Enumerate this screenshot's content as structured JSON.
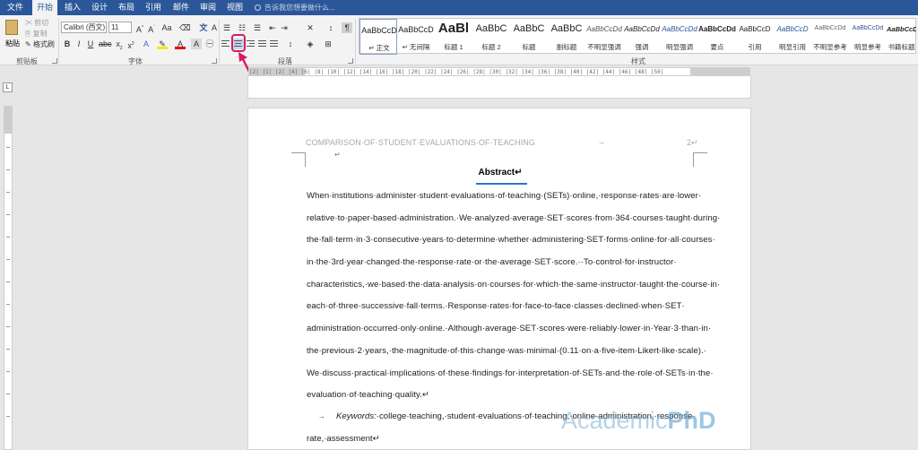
{
  "tabs": [
    "文件",
    "开始",
    "插入",
    "设计",
    "布局",
    "引用",
    "邮件",
    "审阅",
    "视图"
  ],
  "tell_me": "告诉我您想要做什么...",
  "clipboard": {
    "paste": "粘贴",
    "cut": "剪切",
    "copy": "复制",
    "format_painter": "格式刷",
    "group_label": "剪贴板"
  },
  "font": {
    "name": "Calibri (西文)",
    "size": "11",
    "group_label": "字体"
  },
  "paragraph": {
    "group_label": "段落"
  },
  "styles": {
    "group_label": "样式",
    "items": [
      {
        "sample": "AaBbCcD",
        "name": "↵ 正文"
      },
      {
        "sample": "AaBbCcD",
        "name": "↵ 无间隔"
      },
      {
        "sample": "AaBl",
        "name": "标题 1"
      },
      {
        "sample": "AaBbC",
        "name": "标题 2"
      },
      {
        "sample": "AaBbC",
        "name": "标题"
      },
      {
        "sample": "AaBbC",
        "name": "副标题"
      },
      {
        "sample": "AaBbCcDd",
        "name": "不明显强调"
      },
      {
        "sample": "AaBbCcDd",
        "name": "强调"
      },
      {
        "sample": "AaBbCcDd",
        "name": "明显强调"
      },
      {
        "sample": "AaBbCcDd",
        "name": "要点"
      },
      {
        "sample": "AaBbCcD",
        "name": "引用"
      },
      {
        "sample": "AaBbCcD",
        "name": "明显引用"
      },
      {
        "sample": "AaBbCcDd",
        "name": "不明显参考"
      },
      {
        "sample": "AaBbCcDd",
        "name": "明显参考"
      },
      {
        "sample": "AaBbCcDd",
        "name": "书籍标题"
      }
    ]
  },
  "ruler_text": "|2| |1| |2| |4| |6| |8| |10| |12| |14| |16| |18| |20| |22| |24| |26| |28| |30| |32| |34| |36| |38| |40| |42| |44| |46| |48| |50|",
  "document": {
    "header": "COMPARISON·OF·STUDENT·EVALUATIONS·OF·TEACHING",
    "header_tab": "→",
    "page_number": "2↵",
    "header_mark": "↵",
    "abstract_title": "Abstract↵",
    "lines": [
      "When·institutions·administer·student·evaluations·of·teaching·(SETs)·online,·response·rates·are·lower·",
      "relative·to·paper-based·administration.·We·analyzed·average·SET·scores·from·364·courses·taught·during·",
      "the·fall·term·in·3·consecutive·years·to·determine·whether·administering·SET·forms·online·for·all·courses·",
      "in·the·3rd·year·changed·the·response·rate·or·the·average·SET·score.··To·control·for·instructor·",
      "characteristics,·we·based·the·data·analysis·on·courses·for·which·the·same·instructor·taught·the·course·in·",
      "each·of·three·successive·fall·terms.·Response·rates·for·face-to-face·classes·declined·when·SET·",
      "administration·occurred·only·online.·Although·average·SET·scores·were·reliably·lower·in·Year·3·than·in·",
      "the·previous·2·years,·the·magnitude·of·this·change·was·minimal·(0.11·on·a·five-item·Likert-like·scale).·",
      "We·discuss·practical·implications·of·these·findings·for·interpretation·of·SETs·and·the·role·of·SETs·in·the·",
      "evaluation·of·teaching·quality.↵"
    ],
    "keywords_arrow": "→",
    "keywords_label": "Keywords:",
    "keywords_text": "·college·teaching,·student·evaluations·of·teaching,·online·administration,·response·",
    "keywords_cont": "rate,·assessment↵"
  },
  "watermark": {
    "part1": "Academic",
    "part2": "PhD"
  }
}
